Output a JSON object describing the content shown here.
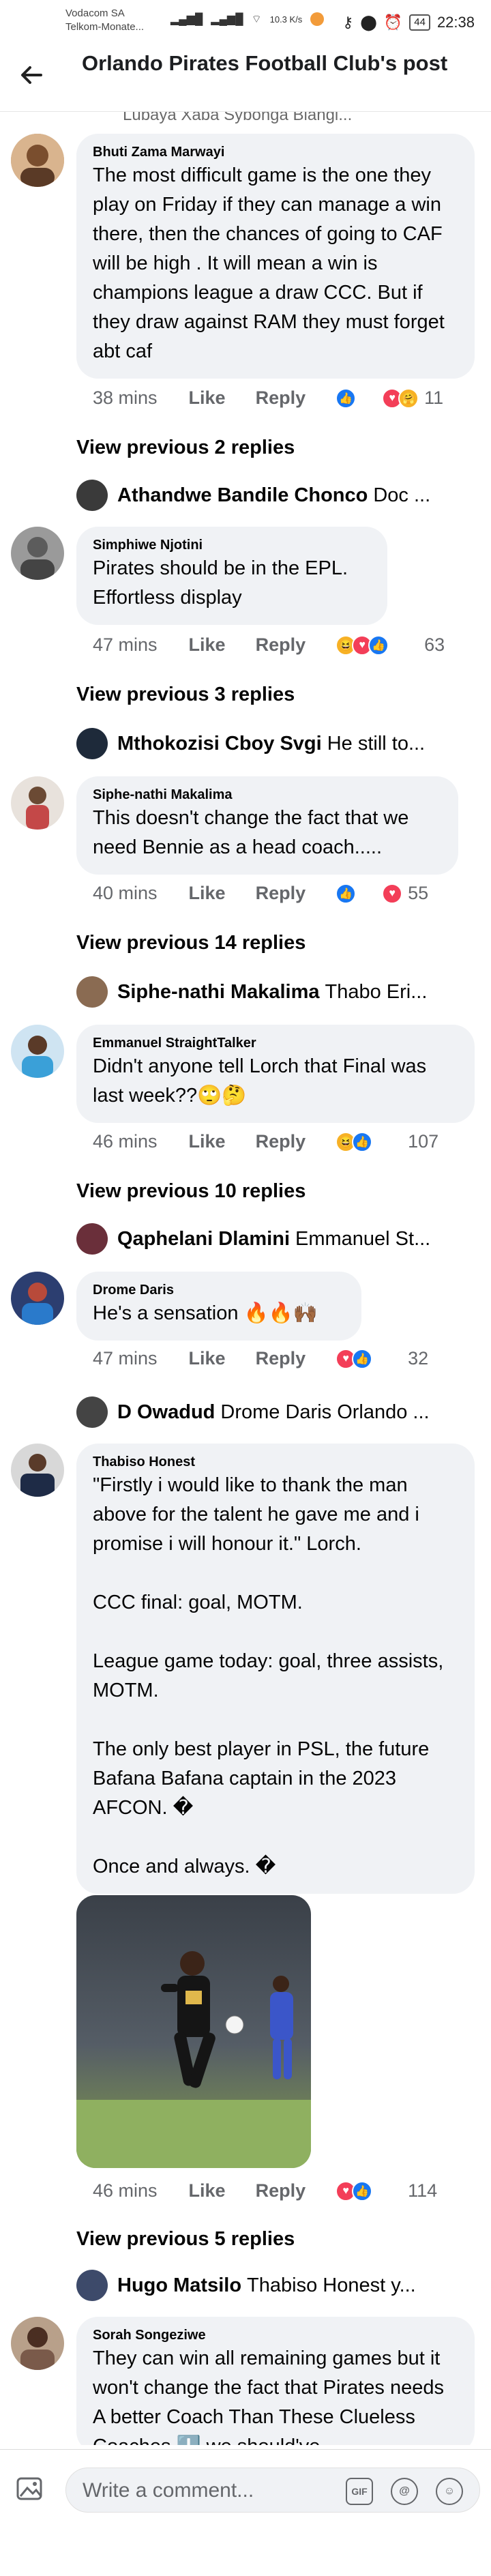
{
  "status": {
    "carrier_line1": "Vodacom SA",
    "carrier_line2": "Telkom-Monate...",
    "speed": "10.3 K/s",
    "battery": "44",
    "time": "22:38"
  },
  "header": {
    "title": "Orlando Pirates Football Club's post"
  },
  "top_cut": "Lubaya Xaba Sybonga Blangi...",
  "comments": [
    {
      "author": "Bhuti Zama Marwayi",
      "text": "The most difficult game is the one they play on Friday if they can manage a win there, then the chances of going to CAF will be high . It will mean a win is champions league a draw CCC. But if they draw against RAM they must forget abt caf",
      "time": "38 mins",
      "like": "Like",
      "reply": "Reply",
      "count": "11",
      "view_previous": "View previous 2 replies",
      "reply_preview": {
        "name": "Athandwe Bandile Chonco",
        "text": "Doc ..."
      }
    },
    {
      "author": "Simphiwe Njotini",
      "text": "Pirates should be in the EPL. Effortless display",
      "time": "47 mins",
      "like": "Like",
      "reply": "Reply",
      "count": "63",
      "view_previous": "View previous 3 replies",
      "reply_preview": {
        "name": "Mthokozisi Cboy Svgi",
        "text": "He still to..."
      }
    },
    {
      "author": "Siphe-nathi Makalima",
      "text": "This doesn't change the fact that we need Bennie as a head coach.....",
      "time": "40 mins",
      "like": "Like",
      "reply": "Reply",
      "count": "55",
      "view_previous": "View previous 14 replies",
      "reply_preview": {
        "name": "Siphe-nathi Makalima",
        "text": "Thabo Eri..."
      }
    },
    {
      "author": "Emmanuel StraightTalker",
      "text": "Didn't anyone tell Lorch that Final was last week??🙄🤔",
      "time": "46 mins",
      "like": "Like",
      "reply": "Reply",
      "count": "107",
      "view_previous": "View previous 10 replies",
      "reply_preview": {
        "name": "Qaphelani Dlamini",
        "text": "Emmanuel St..."
      }
    },
    {
      "author": "Drome Daris",
      "text": "He's a sensation 🔥🔥🙌🏾",
      "time": "47 mins",
      "like": "Like",
      "reply": "Reply",
      "count": "32",
      "reply_preview": {
        "name": "D Owadud",
        "text": "Drome Daris Orlando ..."
      }
    },
    {
      "author": "Thabiso Honest",
      "text": "\"Firstly i would like to thank the man above for the talent he gave me and i promise i will honour it.\" Lorch.\n\nCCC final: goal, MOTM.\n\nLeague game today: goal, three assists, MOTM.\n\nThe only best player in PSL, the future Bafana Bafana captain in the 2023 AFCON. �\n\nOnce and always. �",
      "time": "46 mins",
      "like": "Like",
      "reply": "Reply",
      "count": "114",
      "view_previous": "View previous 5 replies",
      "reply_preview": {
        "name": "Hugo Matsilo",
        "text": "Thabiso Honest y..."
      }
    },
    {
      "author": "Sorah Songeziwe",
      "text": "They can win all remaining games but it won't change the fact that Pirates needs A better Coach Than These Clueless Coaches ⬇️ we should've"
    }
  ],
  "composer": {
    "placeholder": "Write a comment...",
    "gif": "GIF"
  }
}
